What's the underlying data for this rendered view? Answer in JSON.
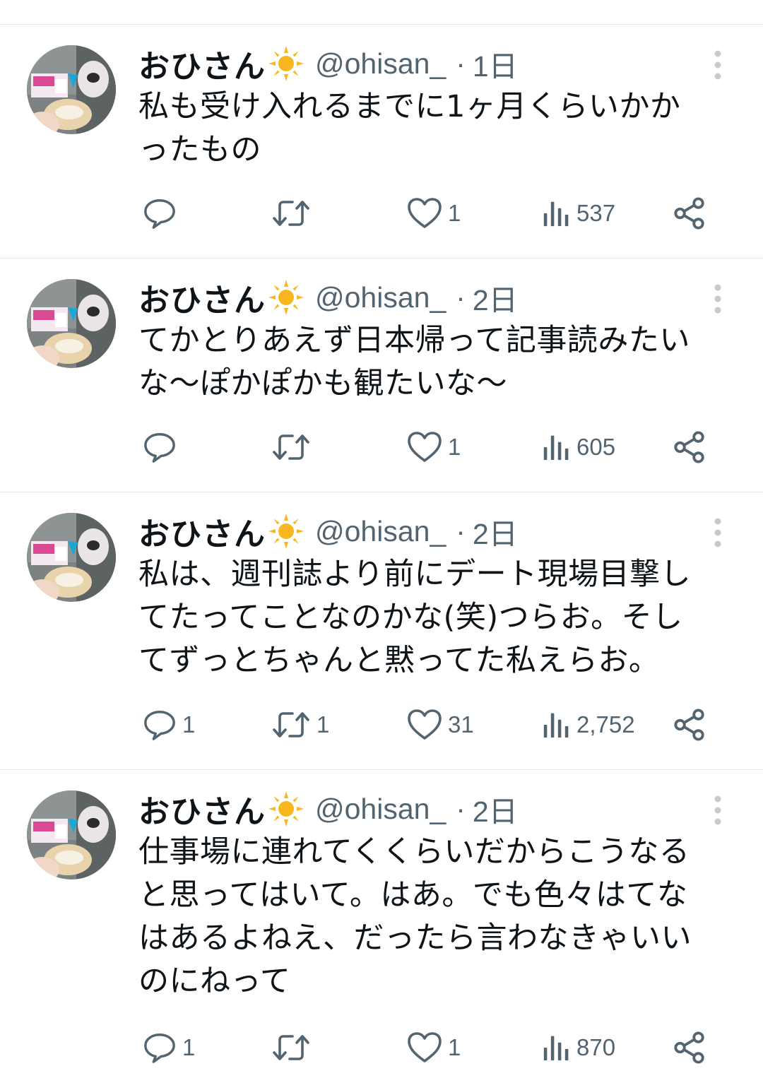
{
  "colors": {
    "text_primary": "#0f1419",
    "text_secondary": "#536471",
    "divider": "#e6e9ec",
    "sun": "#f6b81e"
  },
  "tweets": [
    {
      "author": {
        "display_name": "おひさん",
        "emoji_icon": "sun-icon",
        "handle": "@ohisan_"
      },
      "separator": "·",
      "time": "1日",
      "text": "私も受け入れるまでに1ヶ月くらいかか\nったもの",
      "stats": {
        "replies": "",
        "retweets": "",
        "likes": "1",
        "views": "537"
      }
    },
    {
      "author": {
        "display_name": "おひさん",
        "emoji_icon": "sun-icon",
        "handle": "@ohisan_"
      },
      "separator": "·",
      "time": "2日",
      "text": "てかとりあえず日本帰って記事読みたい\nな〜ぽかぽかも観たいな〜",
      "stats": {
        "replies": "",
        "retweets": "",
        "likes": "1",
        "views": "605"
      }
    },
    {
      "author": {
        "display_name": "おひさん",
        "emoji_icon": "sun-icon",
        "handle": "@ohisan_"
      },
      "separator": "·",
      "time": "2日",
      "text": "私は、週刊誌より前にデート現場目撃し\nてたってことなのかな(笑)つらお。そし\nてずっとちゃんと黙ってた私えらお。",
      "stats": {
        "replies": "1",
        "retweets": "1",
        "likes": "31",
        "views": "2,752"
      }
    },
    {
      "author": {
        "display_name": "おひさん",
        "emoji_icon": "sun-icon",
        "handle": "@ohisan_"
      },
      "separator": "·",
      "time": "2日",
      "text": "仕事場に連れてくくらいだからこうなる\nと思ってはいて。はあ。でも色々はてな\nはあるよねえ、だったら言わなきゃいい\nのにねって",
      "stats": {
        "replies": "1",
        "retweets": "",
        "likes": "1",
        "views": "870"
      }
    }
  ]
}
